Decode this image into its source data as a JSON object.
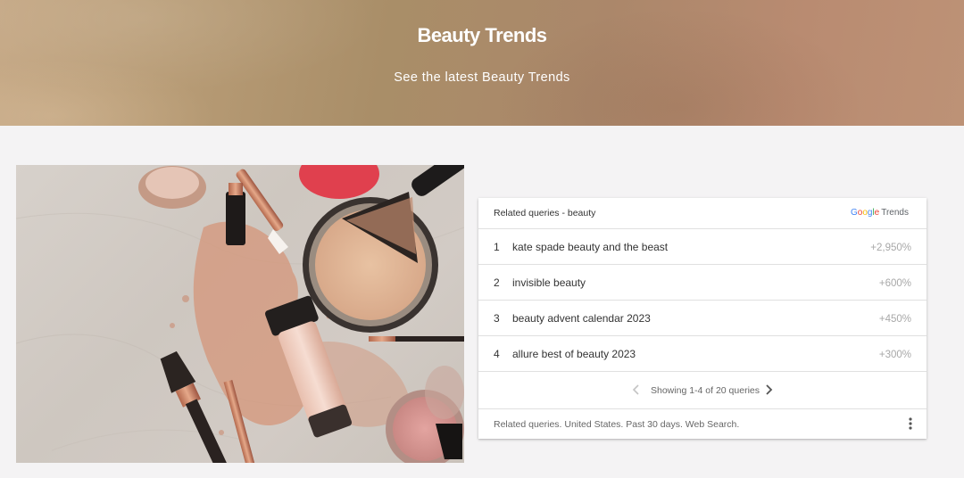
{
  "hero": {
    "title": "Beauty Trends",
    "subtitle": "See the latest Beauty Trends"
  },
  "image": {
    "icon": "makeup-products-photo"
  },
  "widget": {
    "title": "Related queries - beauty",
    "logo": {
      "letters": [
        "G",
        "o",
        "o",
        "g",
        "l",
        "e"
      ],
      "suffix": "Trends"
    },
    "rows": [
      {
        "rank": "1",
        "query": "kate spade beauty and the beast",
        "value": "+2,950%"
      },
      {
        "rank": "2",
        "query": "invisible beauty",
        "value": "+600%"
      },
      {
        "rank": "3",
        "query": "beauty advent calendar 2023",
        "value": "+450%"
      },
      {
        "rank": "4",
        "query": "allure best of beauty 2023",
        "value": "+300%"
      }
    ],
    "pager": {
      "text": "Showing 1-4 of 20 queries"
    },
    "footer": {
      "text": "Related queries. United States. Past 30 days. Web Search."
    }
  },
  "colors": {
    "google_blue": "#4285f4",
    "google_red": "#ea4335",
    "google_yellow": "#fbbc05",
    "google_green": "#34a853"
  }
}
